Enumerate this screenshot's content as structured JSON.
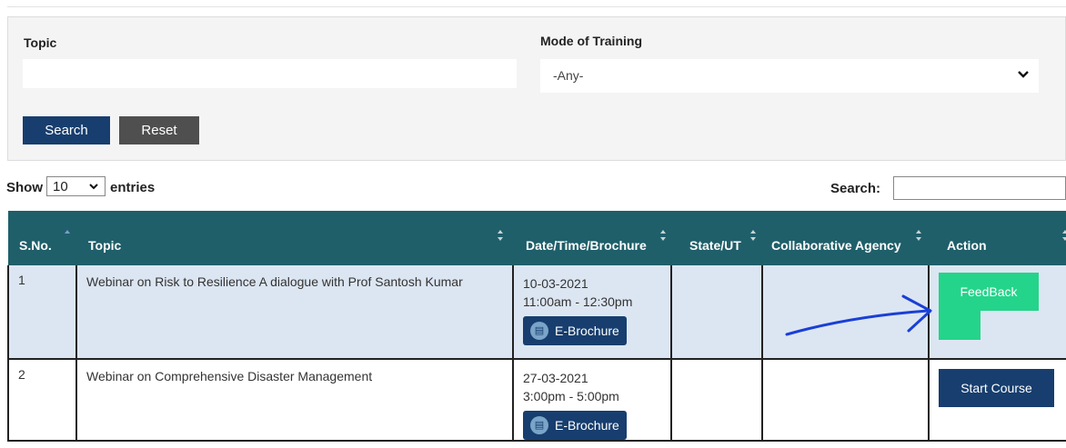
{
  "filters": {
    "topic_label": "Topic",
    "topic_value": "",
    "mode_label": "Mode of Training",
    "mode_value": "-Any-",
    "search_button": "Search",
    "reset_button": "Reset"
  },
  "table_controls": {
    "show_label": "Show",
    "entries_value": "10",
    "entries_label": "entries",
    "search_label": "Search:",
    "search_value": ""
  },
  "table": {
    "headers": [
      "S.No.",
      "Topic",
      "Date/Time/Brochure",
      "State/UT",
      "Collaborative Agency",
      "Action"
    ],
    "rows": [
      {
        "sno": "1",
        "topic": "Webinar on Risk to Resilience A dialogue with Prof Santosh Kumar",
        "date": "10-03-2021",
        "time": "11:00am - 12:30pm",
        "brochure": "E-Brochure",
        "state": "",
        "agency": "",
        "action": "FeedBack"
      },
      {
        "sno": "2",
        "topic": "Webinar on Comprehensive Disaster Management",
        "date": "27-03-2021",
        "time": "3:00pm - 5:00pm",
        "brochure": "E-Brochure",
        "state": "",
        "agency": "",
        "action": "Start Course"
      }
    ]
  },
  "colors": {
    "header_bg": "#1f5f6a",
    "primary_button": "#173e6e",
    "feedback_button": "#24d48a",
    "annotation_arrow": "#1a3fd6"
  }
}
